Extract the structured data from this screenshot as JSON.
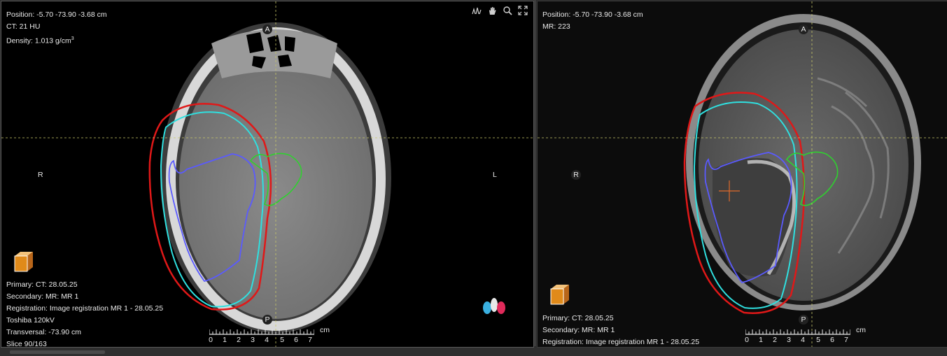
{
  "ct_view": {
    "top_info": {
      "position": "Position: -5.70 -73.90 -3.68 cm",
      "value": "CT: 21 HU",
      "density_prefix": "Density: 1.013 g/cm",
      "density_sup": "3"
    },
    "bottom_info": {
      "primary": "Primary: CT: 28.05.25",
      "secondary": "Secondary: MR: MR 1",
      "registration": "Registration: Image registration MR 1 - 28.05.25",
      "scanner": "Toshiba 120kV",
      "plane": "Transversal: -73.90 cm",
      "slice": "Slice 90/163"
    },
    "orientation": {
      "anterior": "A",
      "posterior": "P",
      "right": "R",
      "left": "L"
    },
    "toolbar_icons": [
      "window-level-icon",
      "pan-hand-icon",
      "zoom-icon",
      "fullscreen-icon"
    ]
  },
  "mr_view": {
    "top_info": {
      "position": "Position: -5.70 -73.90 -3.68 cm",
      "value": "MR: 223"
    },
    "bottom_info": {
      "primary": "Primary: CT: 28.05.25",
      "secondary": "Secondary: MR: MR 1",
      "registration": "Registration: Image registration MR 1 - 28.05.25"
    },
    "orientation": {
      "anterior": "A",
      "posterior": "P",
      "right": "R"
    }
  },
  "scale": {
    "labels": [
      "0",
      "1",
      "2",
      "3",
      "4",
      "5",
      "6",
      "7"
    ],
    "unit": "cm"
  },
  "colors": {
    "contour_red": "#e01818",
    "contour_cyan": "#2fe0e0",
    "contour_blue": "#5a5aff",
    "contour_green": "#2fd12f",
    "crosshair": "#c8c86a",
    "cube": "#e08a1a",
    "marker": "#e06a2a"
  }
}
